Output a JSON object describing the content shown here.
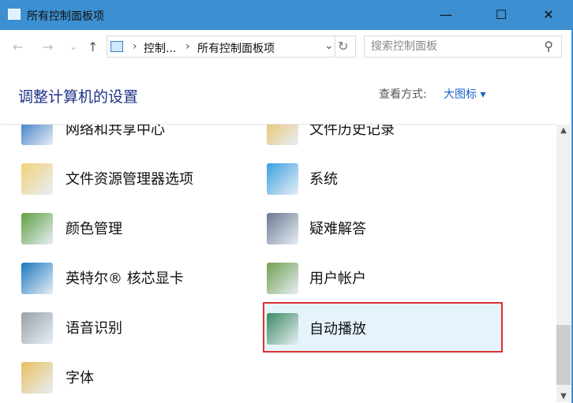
{
  "window": {
    "title": "所有控制面板项",
    "minimize": "—",
    "maximize": "☐",
    "close": "✕"
  },
  "nav": {
    "back": "←",
    "forward": "→",
    "recent": "⌄",
    "up": "↑",
    "refresh": "↻",
    "dropdown": "⌄"
  },
  "address": {
    "crumbs": [
      "控制...",
      "所有控制面板项"
    ],
    "sep": "›"
  },
  "search": {
    "placeholder": "搜索控制面板",
    "icon": "⚲"
  },
  "header": {
    "title": "调整计算机的设置",
    "view_by_label": "查看方式:",
    "view_by_value": "大图标 ▾"
  },
  "items": [
    {
      "label": "网络和共享中心",
      "icon": "network-icon",
      "color": "#2a6fc0"
    },
    {
      "label": "文件历史记录",
      "icon": "file-history-icon",
      "color": "#e8c060"
    },
    {
      "label": "文件资源管理器选项",
      "icon": "folder-options-icon",
      "color": "#f3d27a"
    },
    {
      "label": "系统",
      "icon": "system-icon",
      "color": "#3aa0e0"
    },
    {
      "label": "颜色管理",
      "icon": "color-management-icon",
      "color": "#60a040"
    },
    {
      "label": "疑难解答",
      "icon": "troubleshooting-icon",
      "color": "#6a7a90"
    },
    {
      "label": "英特尔® 核芯显卡",
      "icon": "intel-graphics-icon",
      "color": "#1a78c0"
    },
    {
      "label": "用户帐户",
      "icon": "user-accounts-icon",
      "color": "#70a050"
    },
    {
      "label": "语音识别",
      "icon": "microphone-icon",
      "color": "#9aa0a8"
    },
    {
      "label": "自动播放",
      "icon": "autoplay-icon",
      "color": "#3a8a60"
    },
    {
      "label": "字体",
      "icon": "fonts-icon",
      "color": "#e8c060"
    }
  ],
  "selected_index": 9
}
